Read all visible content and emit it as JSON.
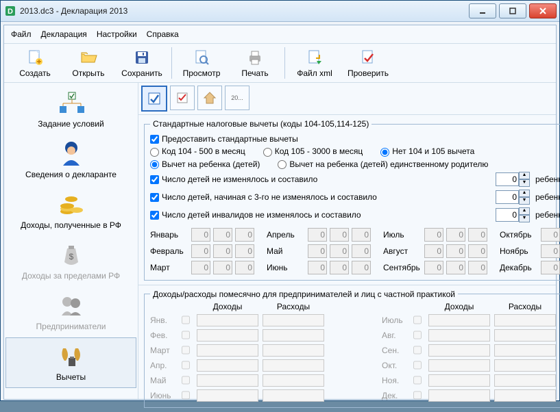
{
  "window": {
    "title": "2013.dc3 - Декларация 2013"
  },
  "menu": {
    "file": "Файл",
    "decl": "Декларация",
    "settings": "Настройки",
    "help": "Справка"
  },
  "toolbar": {
    "create": "Создать",
    "open": "Открыть",
    "save": "Сохранить",
    "preview": "Просмотр",
    "print": "Печать",
    "xml": "Файл xml",
    "check": "Проверить"
  },
  "sidebar": {
    "items": [
      "Задание условий",
      "Сведения о декларанте",
      "Доходы, полученные в РФ",
      "Доходы за пределами РФ",
      "Предприниматели",
      "Вычеты"
    ]
  },
  "mini": {
    "year": "20..."
  },
  "std": {
    "legend": "Стандартные налоговые вычеты (коды 104-105,114-125)",
    "provide": "Предоставить стандартные вычеты",
    "code104": "Код 104 - 500 в месяц",
    "code105": "Код 105 - 3000 в месяц",
    "no104105": "Нет 104 и 105 вычета",
    "q": "?",
    "childDeduct": "Вычет на ребенка (детей)",
    "childSingle": "Вычет на ребенка (детей) единственному родителю",
    "childrenStable": "Число детей не изменялось и составило",
    "childrenFrom3": "Число детей, начиная с 3-го не изменялось и составило",
    "childrenInvalid": "Число детей инвалидов не изменялось и составило",
    "childSuffix": "ребенка (детей)",
    "val1": "0",
    "val2": "0",
    "val3": "0"
  },
  "months": {
    "jan": "Январь",
    "feb": "Февраль",
    "mar": "Март",
    "apr": "Апрель",
    "may": "Май",
    "jun": "Июнь",
    "jul": "Июль",
    "aug": "Август",
    "sep": "Сентябрь",
    "oct": "Октябрь",
    "nov": "Ноябрь",
    "dec": "Декабрь",
    "zero": "0"
  },
  "ent": {
    "title": "Доходы/расходы помесячно для предпринимателей и лиц с частной практикой",
    "income": "Доходы",
    "expense": "Расходы",
    "m": {
      "jan": "Янв.",
      "feb": "Фев.",
      "mar": "Март",
      "apr": "Апр.",
      "may": "Май",
      "jun": "Июнь",
      "jul": "Июль",
      "aug": "Авг.",
      "sep": "Сен.",
      "oct": "Окт.",
      "nov": "Ноя.",
      "dec": "Дек."
    }
  }
}
